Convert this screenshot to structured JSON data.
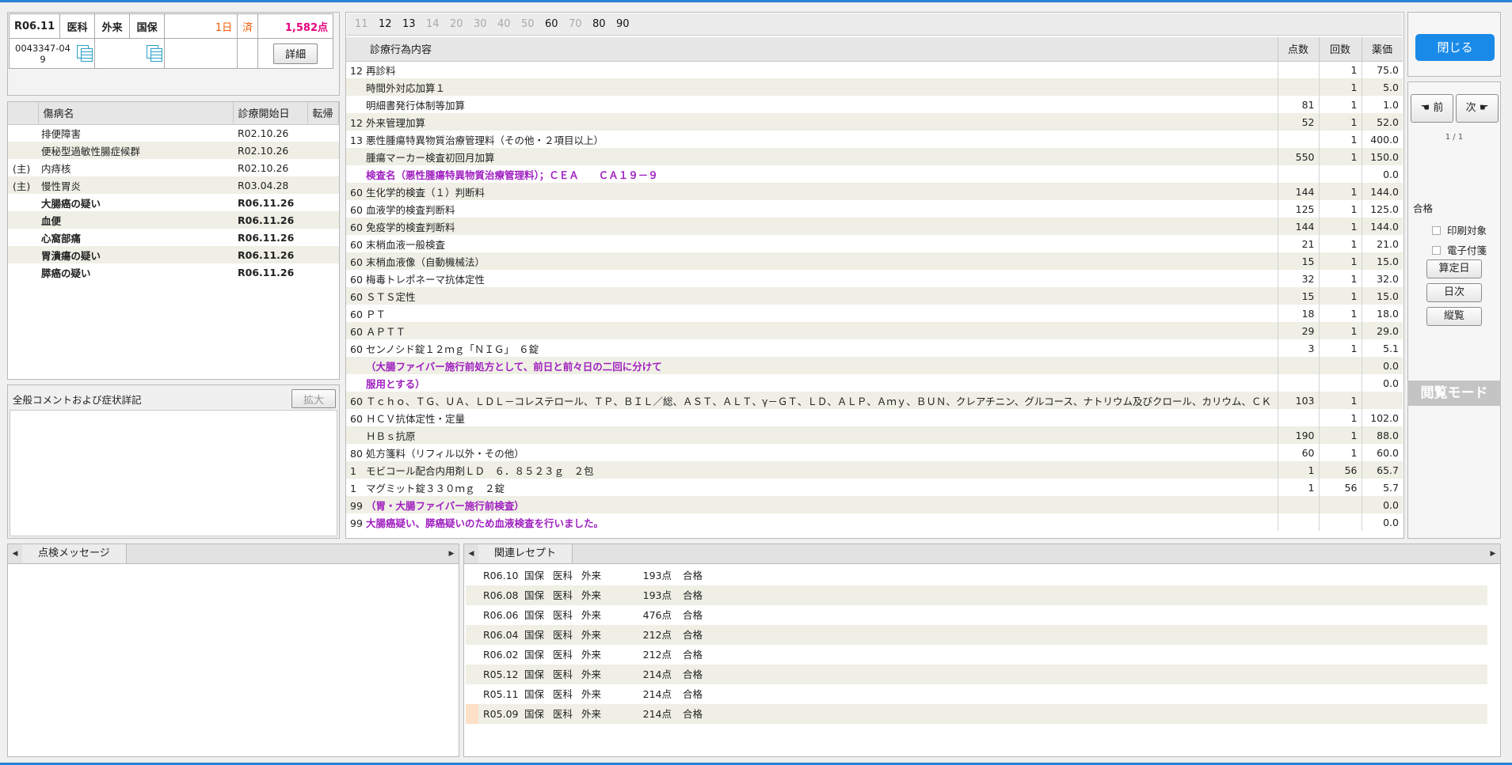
{
  "header": {
    "era": "R06.11",
    "dept": "医科",
    "visit": "外来",
    "insurance": "国保",
    "days": "1日",
    "status": "済",
    "points": "1,582点",
    "patient_id": "0043347-04 9",
    "detail_button": "詳細"
  },
  "disease": {
    "columns": [
      "傷病名",
      "診療開始日",
      "転帰"
    ],
    "rows": [
      {
        "prefix": "",
        "name": "排便障害",
        "date": "R02.10.26",
        "outcome": "",
        "bold": false
      },
      {
        "prefix": "",
        "name": "便秘型過敏性腸症候群",
        "date": "R02.10.26",
        "outcome": "",
        "bold": false
      },
      {
        "prefix": "(主)",
        "name": "内痔核",
        "date": "R02.10.26",
        "outcome": "",
        "bold": false
      },
      {
        "prefix": "(主)",
        "name": "慢性胃炎",
        "date": "R03.04.28",
        "outcome": "",
        "bold": false
      },
      {
        "prefix": "",
        "name": "大腸癌の疑い",
        "date": "R06.11.26",
        "outcome": "",
        "bold": true
      },
      {
        "prefix": "",
        "name": "血便",
        "date": "R06.11.26",
        "outcome": "",
        "bold": true
      },
      {
        "prefix": "",
        "name": "心窩部痛",
        "date": "R06.11.26",
        "outcome": "",
        "bold": true
      },
      {
        "prefix": "",
        "name": "胃潰瘍の疑い",
        "date": "R06.11.26",
        "outcome": "",
        "bold": true
      },
      {
        "prefix": "",
        "name": "膵癌の疑い",
        "date": "R06.11.26",
        "outcome": "",
        "bold": true
      }
    ]
  },
  "comment": {
    "title": "全般コメントおよび症状詳記",
    "expand_button": "拡大"
  },
  "tabs": [
    "11",
    "12",
    "13",
    "14",
    "20",
    "30",
    "40",
    "50",
    "60",
    "70",
    "80",
    "90"
  ],
  "tabs_active": [
    "12",
    "13",
    "60",
    "80",
    "90"
  ],
  "details": {
    "columns": [
      "診療行為内容",
      "点数",
      "回数",
      "薬価"
    ],
    "rows": [
      {
        "code": "12",
        "text": "再診料",
        "points": "",
        "count": "1",
        "price": "75.0",
        "purple": false
      },
      {
        "code": "",
        "text": "時間外対応加算１",
        "points": "",
        "count": "1",
        "price": "5.0",
        "purple": false
      },
      {
        "code": "",
        "text": "明細書発行体制等加算",
        "points": "81",
        "count": "1",
        "price": "1.0",
        "purple": false
      },
      {
        "code": "12",
        "text": "外来管理加算",
        "points": "52",
        "count": "1",
        "price": "52.0",
        "purple": false
      },
      {
        "code": "13",
        "text": "悪性腫瘍特異物質治療管理料（その他・２項目以上）",
        "points": "",
        "count": "1",
        "price": "400.0",
        "purple": false
      },
      {
        "code": "",
        "text": "腫瘍マーカー検査初回月加算",
        "points": "550",
        "count": "1",
        "price": "150.0",
        "purple": false
      },
      {
        "code": "",
        "text": "検査名（悪性腫瘍特異物質治療管理料）；ＣＥＡ　　ＣＡ１９－９",
        "points": "",
        "count": "",
        "price": "0.0",
        "purple": true
      },
      {
        "code": "60",
        "text": "生化学的検査（１）判断料",
        "points": "144",
        "count": "1",
        "price": "144.0",
        "purple": false
      },
      {
        "code": "60",
        "text": "血液学的検査判断料",
        "points": "125",
        "count": "1",
        "price": "125.0",
        "purple": false
      },
      {
        "code": "60",
        "text": "免疫学的検査判断料",
        "points": "144",
        "count": "1",
        "price": "144.0",
        "purple": false
      },
      {
        "code": "60",
        "text": "末梢血液一般検査",
        "points": "21",
        "count": "1",
        "price": "21.0",
        "purple": false
      },
      {
        "code": "60",
        "text": "末梢血液像（自動機械法）",
        "points": "15",
        "count": "1",
        "price": "15.0",
        "purple": false
      },
      {
        "code": "60",
        "text": "梅毒トレポネーマ抗体定性",
        "points": "32",
        "count": "1",
        "price": "32.0",
        "purple": false
      },
      {
        "code": "60",
        "text": "ＳＴＳ定性",
        "points": "15",
        "count": "1",
        "price": "15.0",
        "purple": false
      },
      {
        "code": "60",
        "text": "ＰＴ",
        "points": "18",
        "count": "1",
        "price": "18.0",
        "purple": false
      },
      {
        "code": "60",
        "text": "ＡＰＴＴ",
        "points": "29",
        "count": "1",
        "price": "29.0",
        "purple": false
      },
      {
        "code": "60",
        "text": "センノシド錠１２ｍｇ「ＮＩＧ」　６錠",
        "points": "3",
        "count": "1",
        "price": "5.1",
        "purple": false
      },
      {
        "code": "",
        "text": "（大腸ファイバー施行前処方として、前日と前々日の二回に分けて",
        "points": "",
        "count": "",
        "price": "0.0",
        "purple": true
      },
      {
        "code": "",
        "text": "服用とする）",
        "points": "",
        "count": "",
        "price": "0.0",
        "purple": true
      },
      {
        "code": "60",
        "text": "Ｔｃｈｏ、ＴＧ、ＵＡ、ＬＤＬ－コレステロール、ＴＰ、ＢＩＬ／総、ＡＳＴ、ＡＬＴ、γ－ＧＴ、ＬＤ、ＡＬＰ、Ａｍｙ、ＢＵＮ、クレアチニン、グルコース、ナトリウム及びクロール、カリウム、ＣＫ",
        "points": "103",
        "count": "1",
        "price": "",
        "purple": false
      },
      {
        "code": "60",
        "text": "ＨＣＶ抗体定性・定量",
        "points": "",
        "count": "1",
        "price": "102.0",
        "purple": false
      },
      {
        "code": "",
        "text": "ＨＢｓ抗原",
        "points": "190",
        "count": "1",
        "price": "88.0",
        "purple": false
      },
      {
        "code": "80",
        "text": "処方箋料（リフィル以外・その他）",
        "points": "60",
        "count": "1",
        "price": "60.0",
        "purple": false
      },
      {
        "code": "1",
        "text": "モビコール配合内用剤ＬＤ　６．８５２３ｇ　２包",
        "points": "1",
        "count": "56",
        "price": "65.7",
        "purple": false
      },
      {
        "code": "1",
        "text": "マグミット錠３３０ｍｇ　２錠",
        "points": "1",
        "count": "56",
        "price": "5.7",
        "purple": false
      },
      {
        "code": "99",
        "text": "（胃・大腸ファイバー施行前検査）",
        "points": "",
        "count": "",
        "price": "0.0",
        "purple": true
      },
      {
        "code": "99",
        "text": "大腸癌疑い、膵癌疑いのため血液検査を行いました。",
        "points": "",
        "count": "",
        "price": "0.0",
        "purple": true
      }
    ]
  },
  "side": {
    "close": "閉じる",
    "prev": "前",
    "next": "次",
    "page": "1 / 1",
    "result": "合格",
    "print_target": "印刷対象",
    "e_sticky": "電子付箋",
    "calc_date": "算定日",
    "daily": "日次",
    "vertical": "縦覧",
    "mode": "閲覧モード"
  },
  "bottom": {
    "check_tab": "点検メッセージ",
    "related_tab": "関連レセプト",
    "related": [
      {
        "month": "R06.10",
        "ins": "国保",
        "dept": "医科",
        "visit": "外来",
        "points": "193点",
        "result": "合格"
      },
      {
        "month": "R06.08",
        "ins": "国保",
        "dept": "医科",
        "visit": "外来",
        "points": "193点",
        "result": "合格"
      },
      {
        "month": "R06.06",
        "ins": "国保",
        "dept": "医科",
        "visit": "外来",
        "points": "476点",
        "result": "合格"
      },
      {
        "month": "R06.04",
        "ins": "国保",
        "dept": "医科",
        "visit": "外来",
        "points": "212点",
        "result": "合格"
      },
      {
        "month": "R06.02",
        "ins": "国保",
        "dept": "医科",
        "visit": "外来",
        "points": "212点",
        "result": "合格"
      },
      {
        "month": "R05.12",
        "ins": "国保",
        "dept": "医科",
        "visit": "外来",
        "points": "214点",
        "result": "合格"
      },
      {
        "month": "R05.11",
        "ins": "国保",
        "dept": "医科",
        "visit": "外来",
        "points": "214点",
        "result": "合格"
      },
      {
        "month": "R05.09",
        "ins": "国保",
        "dept": "医科",
        "visit": "外来",
        "points": "214点",
        "result": "合格"
      }
    ]
  }
}
